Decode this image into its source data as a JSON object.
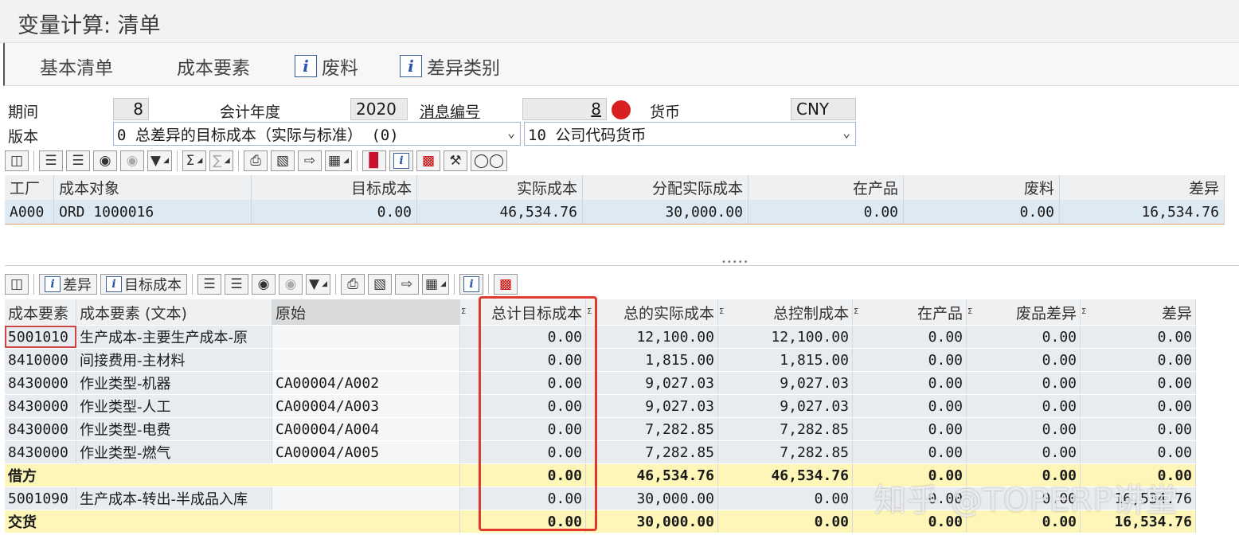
{
  "window": {
    "title": "变量计算: 清单"
  },
  "appbar": {
    "basic_list": "基本清单",
    "cost_elements": "成本要素",
    "scrap": "废料",
    "variance_categories": "差异类别"
  },
  "header": {
    "period_label": "期间",
    "period_value": "8",
    "fiscal_year_label": "会计年度",
    "fiscal_year_value": "2020",
    "message_no_label": "消息编号",
    "message_no_value": "8",
    "currency_label": "货币",
    "currency_value": "CNY",
    "version_label": "版本",
    "version_value": "0 总差异的目标成本（实际与标准） (0)",
    "currency_type_value": "10 公司代码货币"
  },
  "grid_top": {
    "columns": [
      "工厂",
      "成本对象",
      "目标成本",
      "实际成本",
      "分配实际成本",
      "在产品",
      "废料",
      "差异"
    ],
    "rows": [
      [
        "A000",
        "ORD 1000016",
        "0.00",
        "46,534.76",
        "30,000.00",
        "0.00",
        "0.00",
        "16,534.76"
      ]
    ]
  },
  "toolbar_bottom": {
    "variance_btn": "差异",
    "target_cost_btn": "目标成本"
  },
  "grid_bottom": {
    "columns": [
      "成本要素",
      "成本要素 (文本)",
      "原始",
      "总计目标成本",
      "总的实际成本",
      "总控制成本",
      "在产品",
      "废品差异",
      "差异"
    ],
    "rows": [
      {
        "ce": "5001010",
        "text": "生产成本-主要生产成本-原",
        "origin": "",
        "target": "0.00",
        "actual": "12,100.00",
        "control": "12,100.00",
        "wip": "0.00",
        "scrap": "0.00",
        "var": "0.00"
      },
      {
        "ce": "8410000",
        "text": "间接费用-主材料",
        "origin": "",
        "target": "0.00",
        "actual": "1,815.00",
        "control": "1,815.00",
        "wip": "0.00",
        "scrap": "0.00",
        "var": "0.00"
      },
      {
        "ce": "8430000",
        "text": "作业类型-机器",
        "origin": "CA00004/A002",
        "target": "0.00",
        "actual": "9,027.03",
        "control": "9,027.03",
        "wip": "0.00",
        "scrap": "0.00",
        "var": "0.00"
      },
      {
        "ce": "8430000",
        "text": "作业类型-人工",
        "origin": "CA00004/A003",
        "target": "0.00",
        "actual": "9,027.03",
        "control": "9,027.03",
        "wip": "0.00",
        "scrap": "0.00",
        "var": "0.00"
      },
      {
        "ce": "8430000",
        "text": "作业类型-电费",
        "origin": "CA00004/A004",
        "target": "0.00",
        "actual": "7,282.85",
        "control": "7,282.85",
        "wip": "0.00",
        "scrap": "0.00",
        "var": "0.00"
      },
      {
        "ce": "8430000",
        "text": "作业类型-燃气",
        "origin": "CA00004/A005",
        "target": "0.00",
        "actual": "7,282.85",
        "control": "7,282.85",
        "wip": "0.00",
        "scrap": "0.00",
        "var": "0.00"
      }
    ],
    "debit": {
      "label": "借方",
      "target": "0.00",
      "actual": "46,534.76",
      "control": "46,534.76",
      "wip": "0.00",
      "scrap": "0.00",
      "var": "0.00"
    },
    "settle_row": {
      "ce": "5001090",
      "text": "生产成本-转出-半成品入库",
      "origin": "",
      "target": "0.00",
      "actual": "30,000.00",
      "control": "0.00",
      "wip": "0.00",
      "scrap": "0.00",
      "var": "16,534.76"
    },
    "delivery": {
      "label": "交货",
      "target": "0.00",
      "actual": "30,000.00",
      "control": "0.00",
      "wip": "0.00",
      "scrap": "0.00",
      "var": "16,534.76"
    }
  },
  "watermark": "知乎 @TOPERP讲堂",
  "colors": {
    "highlight_box": "#e03a2f",
    "sum_row": "#fdf6b8",
    "selected_row": "#dde9f3"
  }
}
